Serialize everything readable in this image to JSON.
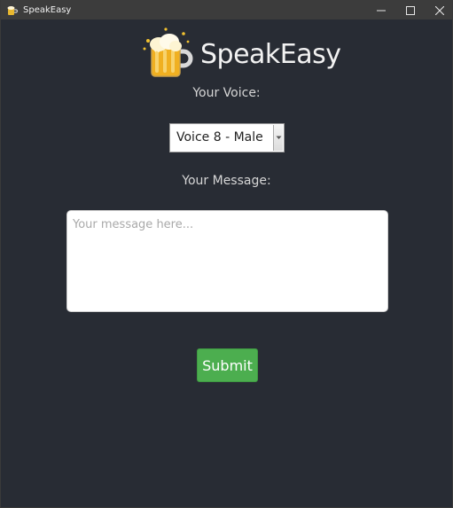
{
  "window": {
    "title": "SpeakEasy",
    "controls": [
      "minimize-icon",
      "maximize-icon",
      "close-icon"
    ]
  },
  "header": {
    "logo_icon": "beer-mug-icon",
    "app_name": "SpeakEasy"
  },
  "form": {
    "voice_label": "Your Voice:",
    "voice_selected": "Voice 8 - Male",
    "message_label": "Your Message:",
    "message_placeholder": "Your message here...",
    "message_value": "",
    "submit_label": "Submit"
  },
  "colors": {
    "background": "#282c34",
    "titlebar": "#3c3c3c",
    "submit": "#4cae4f",
    "text": "#d6d6d6"
  }
}
